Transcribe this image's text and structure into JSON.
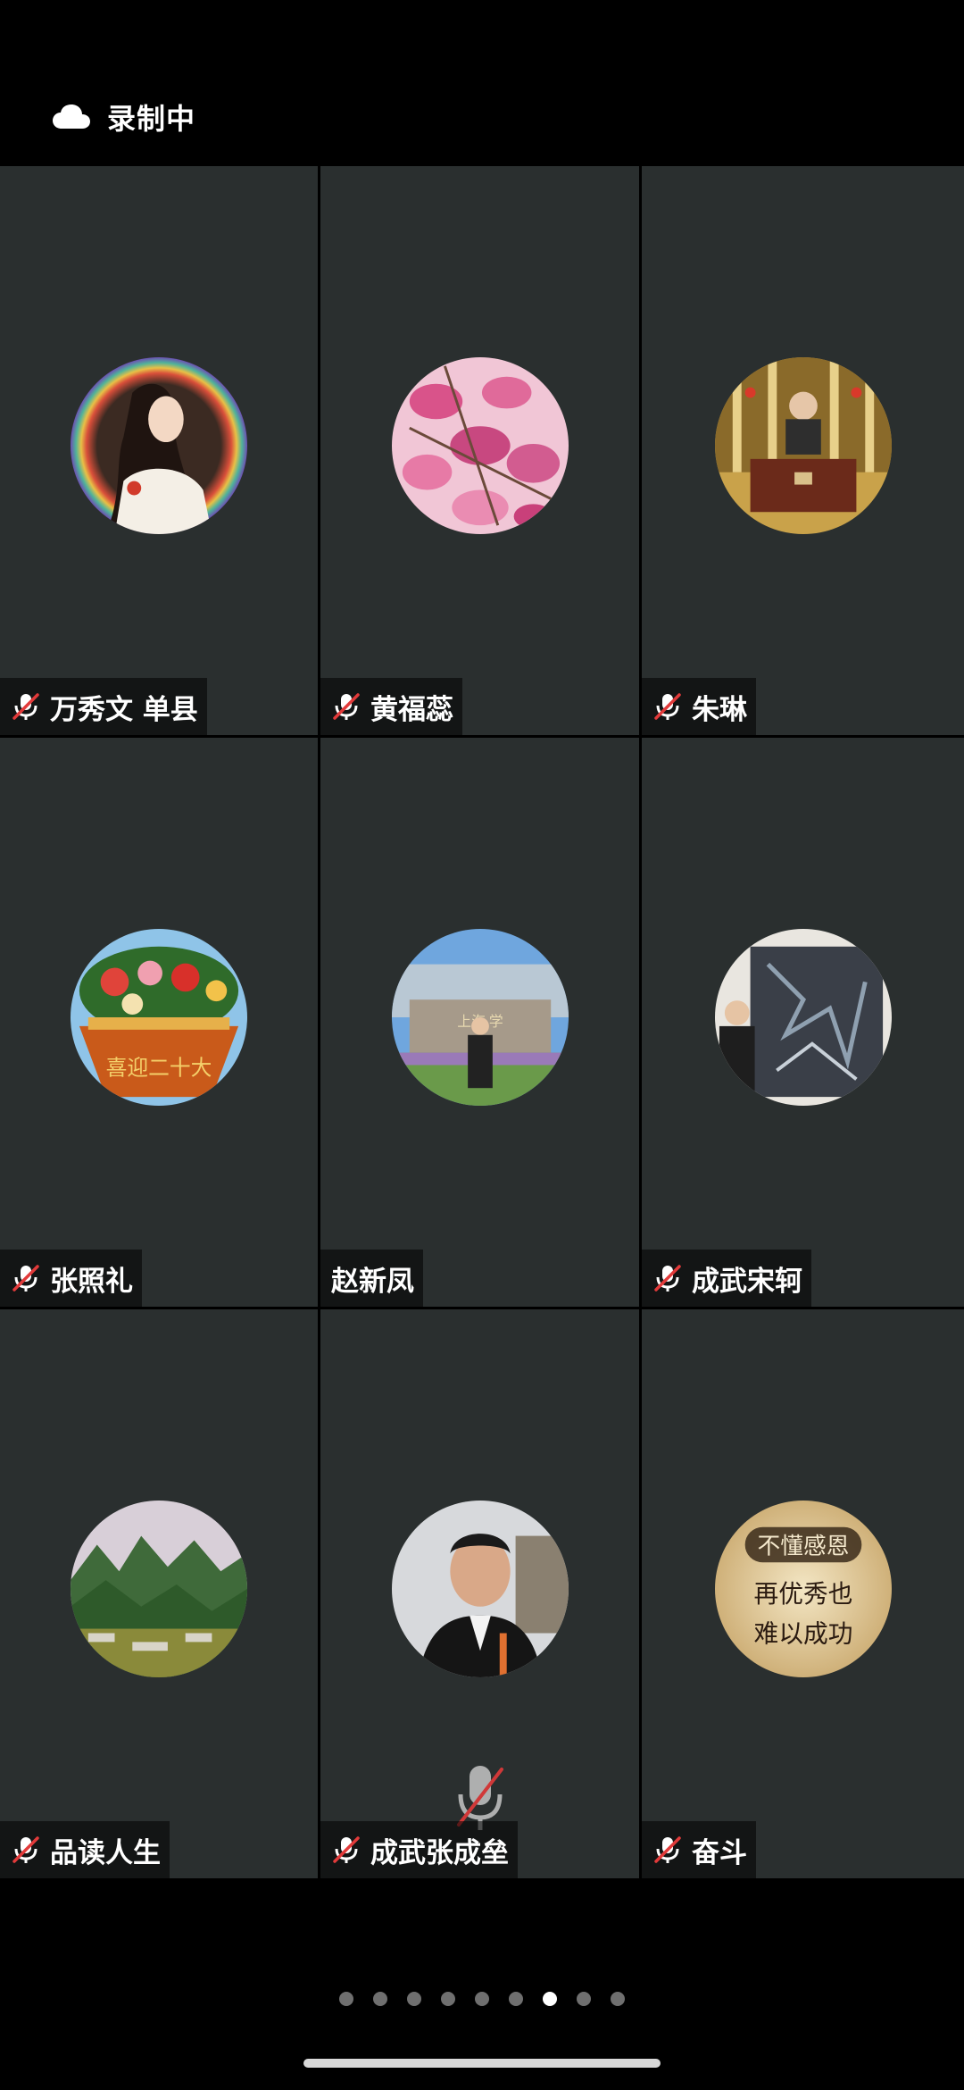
{
  "status": {
    "recording_label": "录制中",
    "cloud_icon": "cloud-icon"
  },
  "participants": [
    {
      "name": "万秀文 单县",
      "muted": true
    },
    {
      "name": "黄福蕊",
      "muted": true
    },
    {
      "name": "朱琳",
      "muted": true
    },
    {
      "name": "张照礼",
      "muted": true
    },
    {
      "name": "赵新凤",
      "muted": false
    },
    {
      "name": "成武宋轲",
      "muted": true
    },
    {
      "name": "品读人生",
      "muted": true
    },
    {
      "name": "成武张成垒",
      "muted": true
    },
    {
      "name": "奋斗",
      "muted": true
    }
  ],
  "avatar_text": {
    "basket_caption": "喜迎二十大",
    "school_sign": "上海 学",
    "calligraphy_line1": "不懂感恩",
    "calligraphy_line2": "再优秀也",
    "calligraphy_line3": "难以成功"
  },
  "pagination": {
    "total_pages": 9,
    "current_page": 7
  },
  "colors": {
    "tile_bg": "#2a2f2f",
    "mute_slash": "#e23a3a",
    "dot_inactive": "#6f6f6f",
    "dot_active": "#ffffff"
  }
}
